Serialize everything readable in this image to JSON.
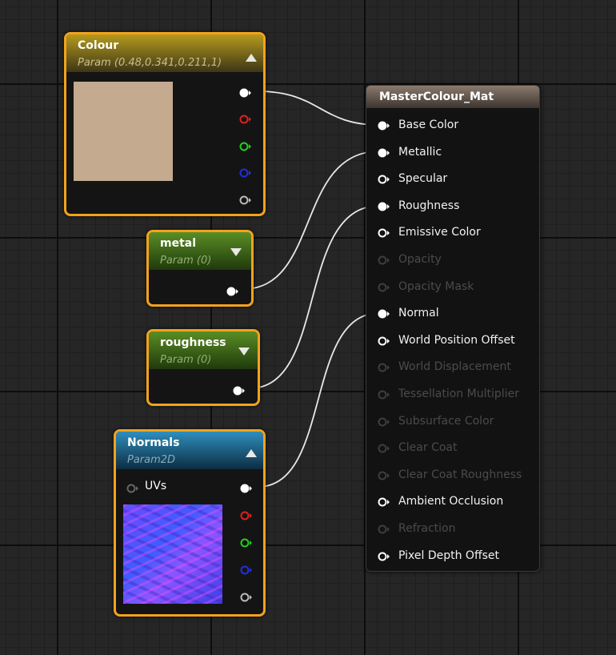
{
  "colors": {
    "wire": "#e8e8e8",
    "selection_border": "#f3a21d",
    "swatch": "#c4aa8e"
  },
  "nodes": {
    "colour": {
      "title": "Colour",
      "subtitle": "Param (0.48,0.341,0.211,1)",
      "collapse_icon": "triangle-up-icon",
      "outputs": [
        "rgb",
        "r",
        "g",
        "b",
        "a"
      ]
    },
    "metal": {
      "title": "metal",
      "subtitle": "Param (0)",
      "collapse_icon": "triangle-down-icon"
    },
    "roughness": {
      "title": "roughness",
      "subtitle": "Param (0)",
      "collapse_icon": "triangle-down-icon"
    },
    "normals": {
      "title": "Normals",
      "subtitle": "Param2D",
      "input_label": "UVs",
      "collapse_icon": "triangle-up-icon"
    },
    "material": {
      "title": "MasterColour_Mat",
      "inputs": [
        {
          "label": "Base Color",
          "enabled": true,
          "connected": true
        },
        {
          "label": "Metallic",
          "enabled": true,
          "connected": true
        },
        {
          "label": "Specular",
          "enabled": true,
          "connected": false
        },
        {
          "label": "Roughness",
          "enabled": true,
          "connected": true
        },
        {
          "label": "Emissive Color",
          "enabled": true,
          "connected": false
        },
        {
          "label": "Opacity",
          "enabled": false,
          "connected": false
        },
        {
          "label": "Opacity Mask",
          "enabled": false,
          "connected": false
        },
        {
          "label": "Normal",
          "enabled": true,
          "connected": true
        },
        {
          "label": "World Position Offset",
          "enabled": true,
          "connected": false
        },
        {
          "label": "World Displacement",
          "enabled": false,
          "connected": false
        },
        {
          "label": "Tessellation Multiplier",
          "enabled": false,
          "connected": false
        },
        {
          "label": "Subsurface Color",
          "enabled": false,
          "connected": false
        },
        {
          "label": "Clear Coat",
          "enabled": false,
          "connected": false
        },
        {
          "label": "Clear Coat Roughness",
          "enabled": false,
          "connected": false
        },
        {
          "label": "Ambient Occlusion",
          "enabled": true,
          "connected": false
        },
        {
          "label": "Refraction",
          "enabled": false,
          "connected": false
        },
        {
          "label": "Pixel Depth Offset",
          "enabled": true,
          "connected": false
        }
      ]
    }
  }
}
